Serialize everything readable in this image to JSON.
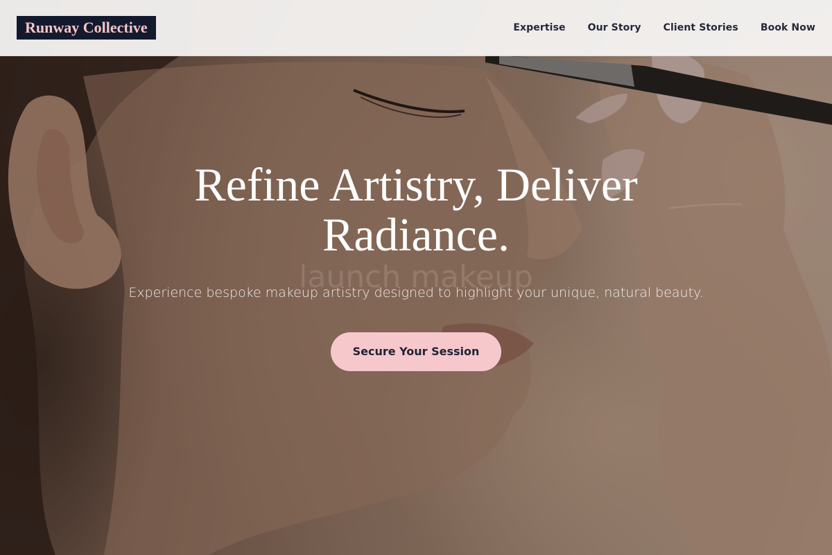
{
  "header": {
    "logo": "Runway Collective",
    "nav": [
      "Expertise",
      "Our Story",
      "Client Stories",
      "Book Now"
    ]
  },
  "hero": {
    "title": "Refine Artistry, Deliver Radiance.",
    "ghost_text": "launch makeup",
    "subtitle": "Experience bespoke makeup artistry designed to highlight your unique, natural beauty.",
    "cta": "Secure Your Session",
    "image": "woman-profile-makeup-brush-photo"
  },
  "colors": {
    "logo_bg": "#141a2e",
    "logo_text": "#f4c5c7",
    "cta_bg": "#f6c8cb",
    "nav_text": "#25283a"
  }
}
